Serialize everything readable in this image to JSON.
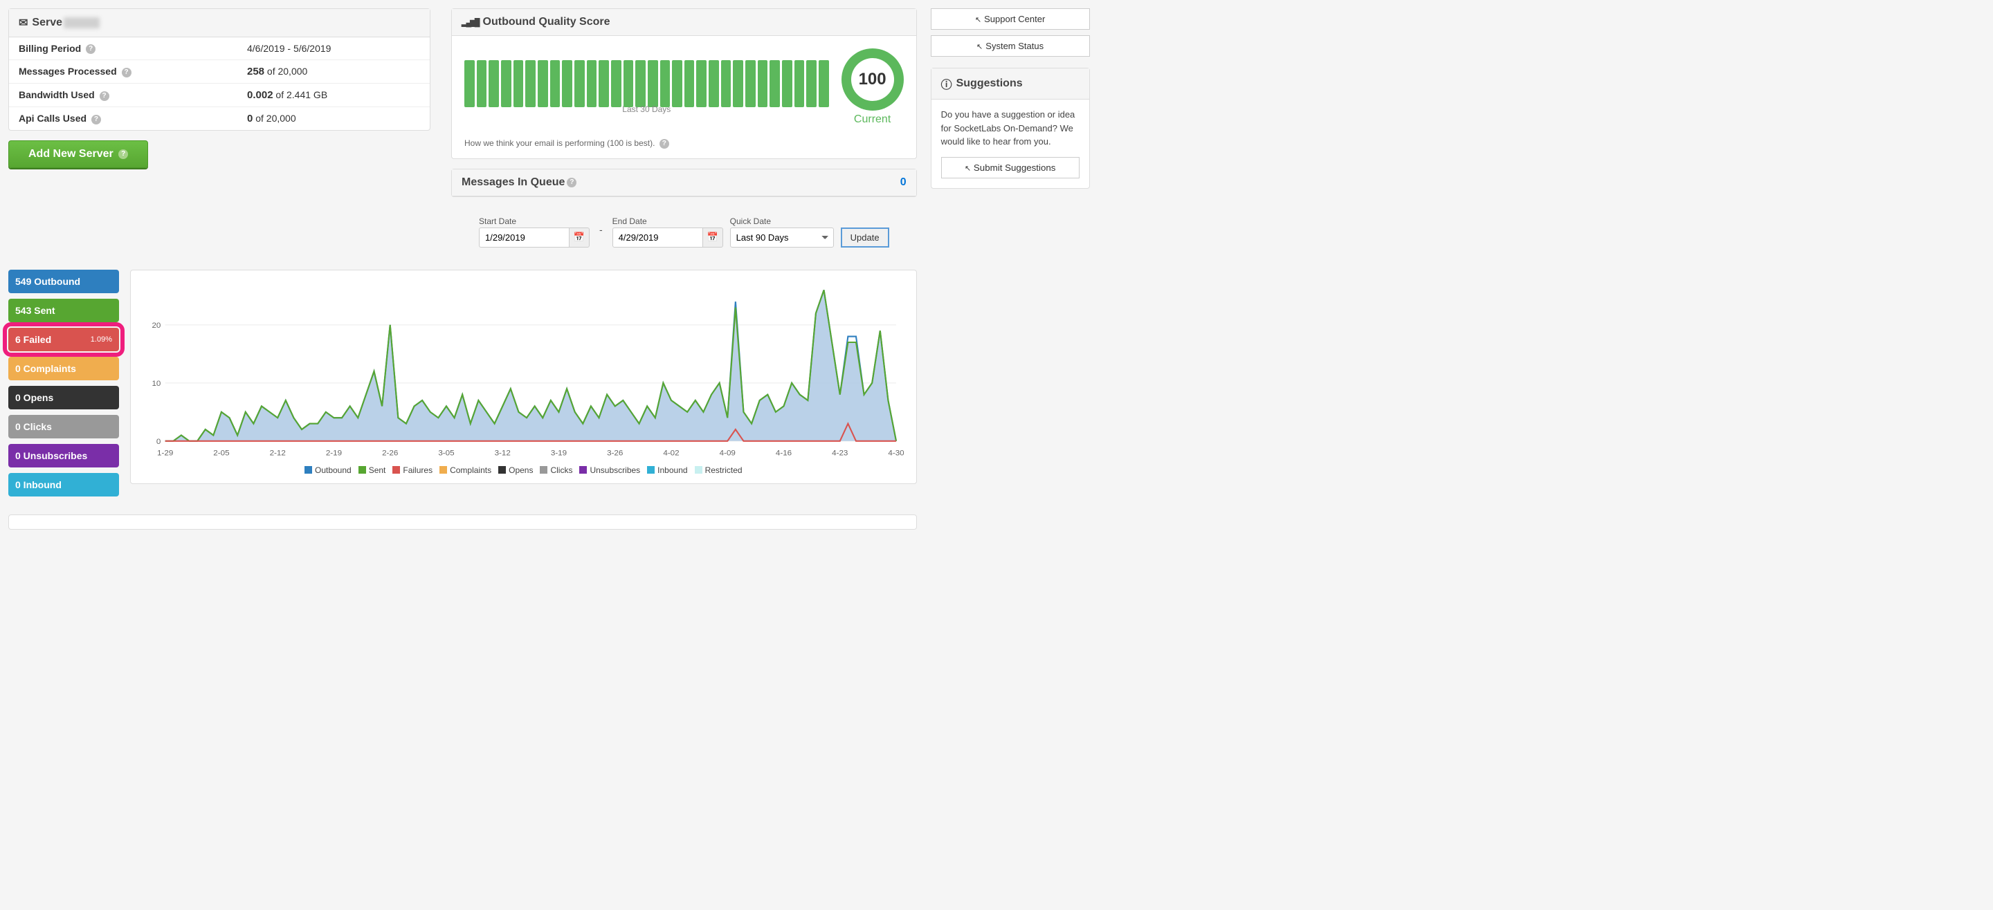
{
  "server_panel": {
    "title_prefix": "Serve",
    "rows": {
      "billing_period_label": "Billing Period",
      "billing_period_value": "4/6/2019 - 5/6/2019",
      "messages_label": "Messages Processed",
      "messages_strong": "258",
      "messages_rest": " of 20,000",
      "bandwidth_label": "Bandwidth Used",
      "bandwidth_strong": "0.002",
      "bandwidth_rest": " of 2.441 GB",
      "api_label": "Api Calls Used",
      "api_strong": "0",
      "api_rest": " of 20,000"
    },
    "add_server_btn": "Add New Server"
  },
  "quality": {
    "title": "Outbound Quality Score",
    "last30": "Last 30 Days",
    "score": "100",
    "current": "Current",
    "foot": "How we think your email is performing (100 is best)."
  },
  "queue": {
    "title": "Messages In Queue",
    "value": "0"
  },
  "filters": {
    "start_label": "Start Date",
    "start_value": "1/29/2019",
    "end_label": "End Date",
    "end_value": "4/29/2019",
    "quick_label": "Quick Date",
    "quick_value": "Last 90 Days",
    "update_btn": "Update"
  },
  "stats": {
    "outbound": "549 Outbound",
    "sent": "543 Sent",
    "failed": "6 Failed",
    "failed_pct": "1.09%",
    "complaints": "0 Complaints",
    "opens": "0 Opens",
    "clicks": "0 Clicks",
    "unsub": "0 Unsubscribes",
    "inbound": "0 Inbound"
  },
  "legend": {
    "outbound": "Outbound",
    "sent": "Sent",
    "failures": "Failures",
    "complaints": "Complaints",
    "opens": "Opens",
    "clicks": "Clicks",
    "unsub": "Unsubscribes",
    "inbound": "Inbound",
    "restricted": "Restricted"
  },
  "sidebar": {
    "support": "Support Center",
    "status": "System Status",
    "sugg_title": "Suggestions",
    "sugg_body": "Do you have a suggestion or idea for SocketLabs On-Demand? We would like to hear from you.",
    "sugg_btn": "Submit Suggestions"
  },
  "chart_data": {
    "type": "line",
    "title": "",
    "xlabel": "",
    "ylabel": "",
    "ylim": [
      0,
      26
    ],
    "yticks": [
      0,
      10,
      20
    ],
    "x_tick_labels": [
      "1-29",
      "2-05",
      "2-12",
      "2-19",
      "2-26",
      "3-05",
      "3-12",
      "3-19",
      "3-26",
      "4-02",
      "4-09",
      "4-16",
      "4-23",
      "4-30"
    ],
    "series": [
      {
        "name": "Outbound",
        "color": "#2e7fbf",
        "values": [
          0,
          0,
          1,
          0,
          0,
          2,
          1,
          5,
          4,
          1,
          5,
          3,
          6,
          5,
          4,
          7,
          4,
          2,
          3,
          3,
          5,
          4,
          4,
          6,
          4,
          8,
          12,
          6,
          20,
          4,
          3,
          6,
          7,
          5,
          4,
          6,
          4,
          8,
          3,
          7,
          5,
          3,
          6,
          9,
          5,
          4,
          6,
          4,
          7,
          5,
          9,
          5,
          3,
          6,
          4,
          8,
          6,
          7,
          5,
          3,
          6,
          4,
          10,
          7,
          6,
          5,
          7,
          5,
          8,
          10,
          4,
          24,
          5,
          3,
          7,
          8,
          5,
          6,
          10,
          8,
          7,
          22,
          26,
          17,
          8,
          18,
          18,
          8,
          10,
          19,
          7,
          0
        ]
      },
      {
        "name": "Sent",
        "color": "#57a631",
        "values": [
          0,
          0,
          1,
          0,
          0,
          2,
          1,
          5,
          4,
          1,
          5,
          3,
          6,
          5,
          4,
          7,
          4,
          2,
          3,
          3,
          5,
          4,
          4,
          6,
          4,
          8,
          12,
          6,
          20,
          4,
          3,
          6,
          7,
          5,
          4,
          6,
          4,
          8,
          3,
          7,
          5,
          3,
          6,
          9,
          5,
          4,
          6,
          4,
          7,
          5,
          9,
          5,
          3,
          6,
          4,
          8,
          6,
          7,
          5,
          3,
          6,
          4,
          10,
          7,
          6,
          5,
          7,
          5,
          8,
          10,
          4,
          23,
          5,
          3,
          7,
          8,
          5,
          6,
          10,
          8,
          7,
          22,
          26,
          17,
          8,
          17,
          17,
          8,
          10,
          19,
          7,
          0
        ]
      },
      {
        "name": "Failures",
        "color": "#d9534f",
        "values": [
          0,
          0,
          0,
          0,
          0,
          0,
          0,
          0,
          0,
          0,
          0,
          0,
          0,
          0,
          0,
          0,
          0,
          0,
          0,
          0,
          0,
          0,
          0,
          0,
          0,
          0,
          0,
          0,
          0,
          0,
          0,
          0,
          0,
          0,
          0,
          0,
          0,
          0,
          0,
          0,
          0,
          0,
          0,
          0,
          0,
          0,
          0,
          0,
          0,
          0,
          0,
          0,
          0,
          0,
          0,
          0,
          0,
          0,
          0,
          0,
          0,
          0,
          0,
          0,
          0,
          0,
          0,
          0,
          0,
          0,
          0,
          2,
          0,
          0,
          0,
          0,
          0,
          0,
          0,
          0,
          0,
          0,
          0,
          0,
          0,
          3,
          0,
          0,
          0,
          0,
          0,
          0
        ]
      }
    ]
  }
}
